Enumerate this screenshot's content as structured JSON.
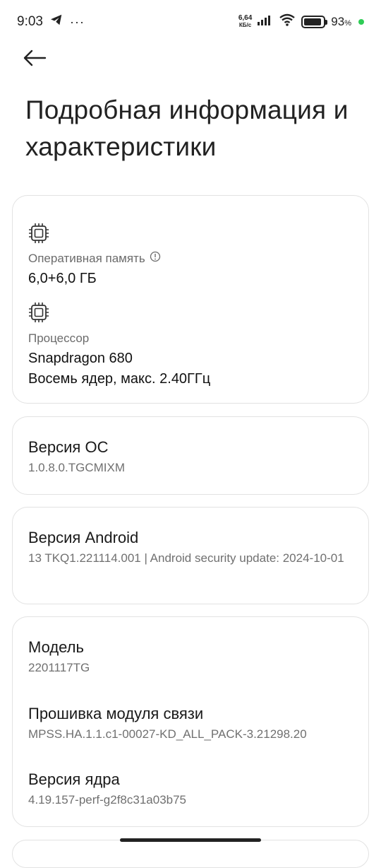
{
  "status_bar": {
    "time": "9:03",
    "more": "···",
    "net_speed_value": "6,64",
    "net_speed_unit": "КБ/с",
    "battery_percent": "93",
    "battery_percent_sign": "%",
    "battery_level": 0.93,
    "charge_color": "#2ecc55"
  },
  "page": {
    "title": "Подробная информация и характеристики"
  },
  "hardware": {
    "ram_label": "Оперативная память",
    "ram_value": "6,0+6,0 ГБ",
    "cpu_label": "Процессор",
    "cpu_model": "Snapdragon 680",
    "cpu_detail": "Восемь ядер, макс. 2.40ГГц"
  },
  "os_version": {
    "title": "Версия ОС",
    "value": "1.0.8.0.TGCMIXM"
  },
  "android_version": {
    "title": "Версия Android",
    "value": "13 TKQ1.221114.001 | Android security update: 2024-10-01"
  },
  "model_card": {
    "model_title": "Модель",
    "model_value": "2201117TG",
    "baseband_title": "Прошивка модуля связи",
    "baseband_value": "MPSS.HA.1.1.c1-00027-KD_ALL_PACK-3.21298.20",
    "kernel_title": "Версия ядра",
    "kernel_value": "4.19.157-perf-g2f8c31a03b75"
  },
  "icons": {
    "back": "arrow-left-icon",
    "chip": "chip-icon",
    "info": "info-icon",
    "telegram": "telegram-icon",
    "signal": "signal-icon",
    "wifi": "wifi-icon",
    "battery": "battery-icon"
  }
}
